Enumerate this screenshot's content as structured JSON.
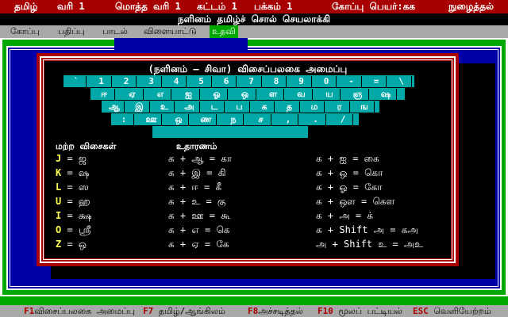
{
  "status": {
    "mode": "தமிழ்",
    "line_label": "வரி 1",
    "total_lines_label": "மொத்த வரி 1",
    "paragraph_label": "கட்டம் 1",
    "page_label": "பக்கம் 1",
    "file_label": "கோப்பு பெயர்:கக",
    "insert_label": "நுழைத்தல்"
  },
  "app_title": "நளினம் தமிழ்ச் சொல் செயலாக்கி",
  "menu": {
    "items": [
      {
        "label": "கோப்பு"
      },
      {
        "label": "பதிப்பு"
      },
      {
        "label": "பாடல்"
      },
      {
        "label": "விளையாட்டு"
      },
      {
        "label": "உதவி"
      }
    ]
  },
  "dialog": {
    "title": "(நளினம் – சிவா) விசைப்பலகை அமைப்பு",
    "keyboard": {
      "row1": [
        "`",
        "1",
        "2",
        "3",
        "4",
        "5",
        "6",
        "7",
        "8",
        "9",
        "0",
        "-",
        "=",
        "\\"
      ],
      "row2": [
        "ஈ",
        "ஏ",
        "எ",
        "ஐ",
        "ஓ",
        "ஒ",
        "ள",
        "வ",
        "ய",
        "ஞ",
        "ஷ"
      ],
      "row3": [
        "ஆ",
        "இ",
        "உ",
        "அ",
        "ட",
        "ப",
        "க",
        "த",
        "ம",
        "ர",
        "ங"
      ],
      "row4": [
        ":",
        "ஊ",
        "ஒ",
        "ண",
        "ந",
        "ச",
        ",",
        ".",
        "/"
      ]
    },
    "other_keys_heading": "மற்ற விசைகள்",
    "examples_heading": "உதாரணம்",
    "rules": [
      {
        "key": "J",
        "eq": "= ஜ",
        "ex1": "க + ஆ = கா",
        "ex2": "க + ஐ = கை"
      },
      {
        "key": "K",
        "eq": "= ஷ",
        "ex1": "க + இ = கி",
        "ex2": "க + ஒ = கொ"
      },
      {
        "key": "L",
        "eq": "= ஸ",
        "ex1": "க + ஈ = கீ",
        "ex2": "க + ஓ = கோ"
      },
      {
        "key": "U",
        "eq": "= ஹ",
        "ex1": "க + உ = கு",
        "ex2": "க + ஔ = கௌ"
      },
      {
        "key": "I",
        "eq": "= க்ஷ",
        "ex1": "க + ஊ = கூ",
        "ex2": "க + அ = க்"
      },
      {
        "key": "O",
        "eq": "= ஸ்ரீ",
        "ex1": "க + எ = கெ",
        "ex2": "க + Shift அ = கஅ"
      },
      {
        "key": "Z",
        "eq": "= ஒ",
        "ex1": "க + ஏ = கே",
        "ex2": "அ + Shift உ = அஉ"
      }
    ]
  },
  "footer": {
    "items": [
      {
        "key": "F1",
        "label": "விசைப்பலகை அமைப்பு"
      },
      {
        "key": "F7",
        "label": "தமிழ்/ஆங்கிலம்"
      },
      {
        "key": "F8",
        "label": "அச்சடித்தல்"
      },
      {
        "key": "F10",
        "label": "மூலப் பட்டியல்"
      },
      {
        "key": "ESC",
        "label": "வெளியேற்றம்"
      }
    ]
  },
  "colors": {
    "status_bg": "#a80000",
    "menu_bg": "#a8a8a8",
    "active_menu_bg": "#00a800",
    "outer_frame": "#00a800",
    "window_bg": "#0000a8",
    "dialog_frame": "#a80000",
    "key_bg": "#00a8a8",
    "rule_key": "#ffff54"
  }
}
